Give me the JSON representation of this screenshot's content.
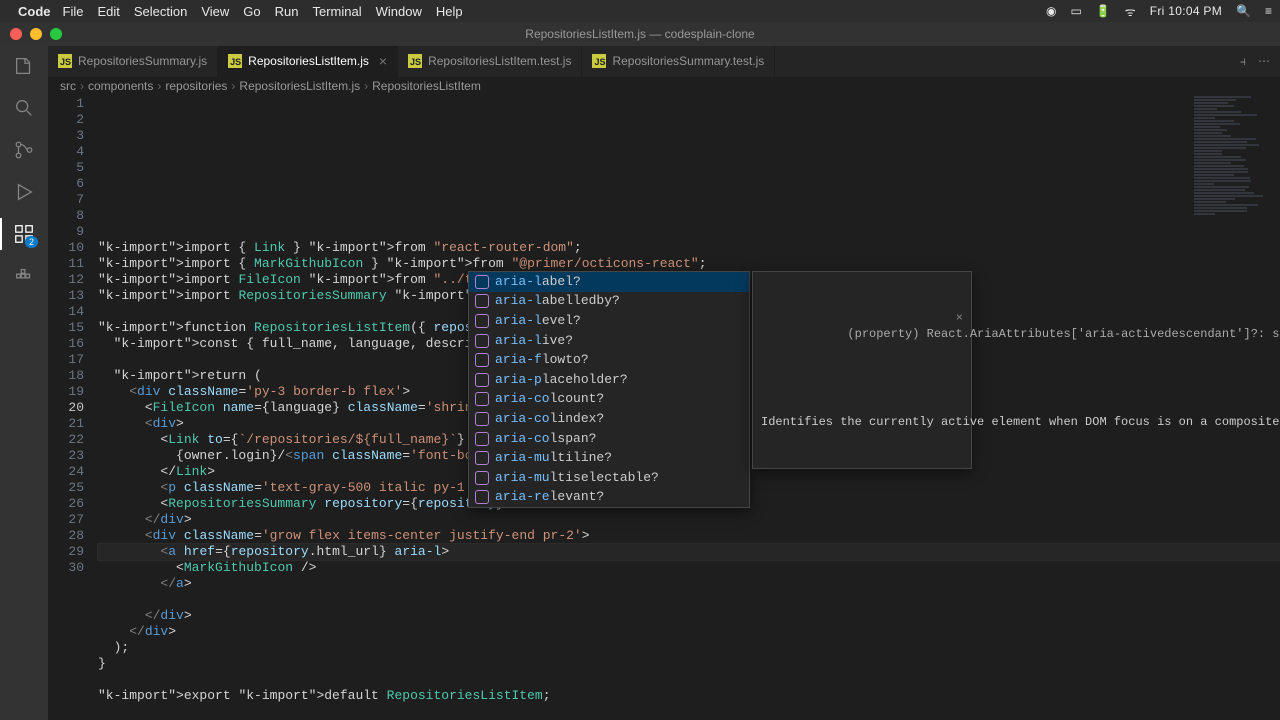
{
  "menubar": {
    "app": "Code",
    "items": [
      "File",
      "Edit",
      "Selection",
      "View",
      "Go",
      "Run",
      "Terminal",
      "Window",
      "Help"
    ],
    "clock": "Fri 10:04 PM"
  },
  "window": {
    "title": "RepositoriesListItem.js — codesplain-clone"
  },
  "tabs": [
    {
      "label": "RepositoriesSummary.js",
      "active": false
    },
    {
      "label": "RepositoriesListItem.js",
      "active": true
    },
    {
      "label": "RepositoriesListItem.test.js",
      "active": false
    },
    {
      "label": "RepositoriesSummary.test.js",
      "active": false
    }
  ],
  "breadcrumb": [
    "src",
    "components",
    "repositories",
    "RepositoriesListItem.js",
    "RepositoriesListItem"
  ],
  "gutter": {
    "start": 1,
    "end": 30,
    "current": 20
  },
  "source": {
    "raw": [
      "import { Link } from \"react-router-dom\";",
      "import { MarkGithubIcon } from \"@primer/octicons-react\";",
      "import FileIcon from \"../tree/FileIcon\";",
      "import RepositoriesSummary from \"./RepositoriesSummary\";",
      "",
      "function RepositoriesListItem({ repository }) {",
      "  const { full_name, language, description, owner, name } = repository;",
      "",
      "  return (",
      "    <div className='py-3 border-b flex'>",
      "      <FileIcon name={language} className='shrink w-6 pt-1' />",
      "      <div>",
      "        <Link to={`/repositories/${full_name}`} className='text-xl'>",
      "          {owner.login}/<span className='font-bold'>{name}</span>",
      "        </Link>",
      "        <p className='text-gray-500 italic py-1'>{description}</p>",
      "        <RepositoriesSummary repository={repository} />",
      "      </div>",
      "      <div className='grow flex items-center justify-end pr-2'>",
      "        <a href={repository.html_url} aria-l>",
      "          <MarkGithubIcon />",
      "        </a>",
      "",
      "      </div>",
      "    </div>",
      "  );",
      "}",
      "",
      "export default RepositoriesListItem;",
      ""
    ]
  },
  "suggest": {
    "items": [
      {
        "prefix": "aria-l",
        "rest": "abel?"
      },
      {
        "prefix": "aria-l",
        "rest": "abelledby?"
      },
      {
        "prefix": "aria-l",
        "rest": "evel?"
      },
      {
        "prefix": "aria-l",
        "rest": "ive?"
      },
      {
        "prefix": "aria-f",
        "rest": "lowto?"
      },
      {
        "prefix": "aria-p",
        "rest": "laceholder?"
      },
      {
        "prefix": "aria-co",
        "rest": "lcount?"
      },
      {
        "prefix": "aria-co",
        "rest": "lindex?"
      },
      {
        "prefix": "aria-co",
        "rest": "lspan?"
      },
      {
        "prefix": "aria-mu",
        "rest": "ltiline?"
      },
      {
        "prefix": "aria-mu",
        "rest": "ltiselectable?"
      },
      {
        "prefix": "aria-re",
        "rest": "levant?"
      }
    ],
    "selected": 0
  },
  "doc": {
    "signature": "(property) React.AriaAttributes['aria-activedescendant']?: string | undefined",
    "description": "Identifies the currently active element when DOM focus is on a composite widget, textbox, group, or application."
  },
  "activity": {
    "ext_badge": "2"
  }
}
